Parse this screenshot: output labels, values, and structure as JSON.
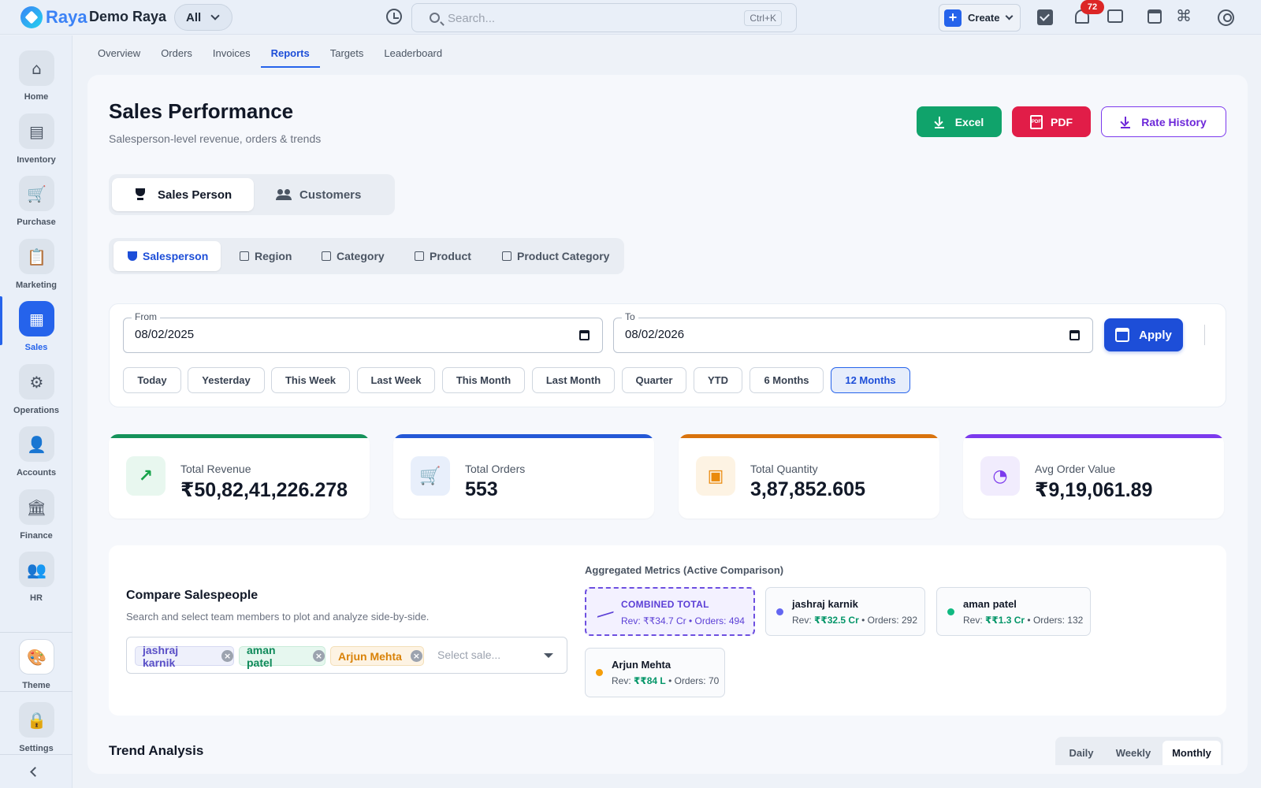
{
  "brand": {
    "logo_text": "Raya",
    "org_name": "Demo Raya",
    "scope": "All"
  },
  "search": {
    "placeholder": "Search...",
    "shortcut": "Ctrl+K"
  },
  "header": {
    "create_label": "Create",
    "notifications_count": "72"
  },
  "sidebar": {
    "items": [
      {
        "label": "Home",
        "icon": "home-icon",
        "glyph": "⌂"
      },
      {
        "label": "Inventory",
        "icon": "archive-icon",
        "glyph": "▤"
      },
      {
        "label": "Purchase",
        "icon": "cart-icon",
        "glyph": "🛒"
      },
      {
        "label": "Marketing",
        "icon": "clipboard-icon",
        "glyph": "📋"
      },
      {
        "label": "Sales",
        "icon": "cash-register-icon",
        "glyph": "▦"
      },
      {
        "label": "Operations",
        "icon": "cog-box-icon",
        "glyph": "⚙"
      },
      {
        "label": "Accounts",
        "icon": "person-icon",
        "glyph": "👤"
      },
      {
        "label": "Finance",
        "icon": "bank-icon",
        "glyph": "🏛"
      },
      {
        "label": "HR",
        "icon": "people-icon",
        "glyph": "👥"
      }
    ],
    "theme_label": "Theme",
    "settings_label": "Settings"
  },
  "tabs": [
    "Overview",
    "Orders",
    "Invoices",
    "Reports",
    "Targets",
    "Leaderboard"
  ],
  "active_tab": "Reports",
  "page": {
    "title": "Sales Performance",
    "subtitle": "Salesperson-level revenue, orders & trends",
    "excel_label": "Excel",
    "pdf_label": "PDF",
    "rate_history_label": "Rate History"
  },
  "view_toggle": {
    "sales_person": "Sales Person",
    "customers": "Customers"
  },
  "dimension_tabs": [
    "Salesperson",
    "Region",
    "Category",
    "Product",
    "Product Category"
  ],
  "filters": {
    "from_label": "From",
    "from_value": "08/02/2025",
    "to_label": "To",
    "to_value": "08/02/2026",
    "apply_label": "Apply",
    "presets": [
      "Today",
      "Yesterday",
      "This Week",
      "Last Week",
      "This Month",
      "Last Month",
      "Quarter",
      "YTD",
      "6 Months",
      "12 Months"
    ],
    "active_preset": "12 Months"
  },
  "kpis": [
    {
      "label": "Total Revenue",
      "value": "₹50,82,41,226.278",
      "color": "#16a34a"
    },
    {
      "label": "Total Orders",
      "value": "553",
      "color": "#2563eb"
    },
    {
      "label": "Total Quantity",
      "value": "3,87,852.605",
      "color": "#ea8a0c"
    },
    {
      "label": "Avg Order Value",
      "value": "₹9,19,061.89",
      "color": "#7c3aed"
    }
  ],
  "compare": {
    "title": "Compare Salespeople",
    "subtitle": "Search and select team members to plot and analyze side-by-side.",
    "selected": [
      "jashraj karnik",
      "aman patel",
      "Arjun Mehta"
    ],
    "placeholder": "Select sale...",
    "agg_title": "Aggregated Metrics (Active Comparison)",
    "combined": {
      "name": "COMBINED TOTAL",
      "rev": "₹₹34.7 Cr",
      "orders": "494"
    },
    "people": [
      {
        "name": "jashraj karnik",
        "rev": "₹₹32.5 Cr",
        "orders": "292",
        "color": "#6366f1"
      },
      {
        "name": "aman patel",
        "rev": "₹₹1.3 Cr",
        "orders": "132",
        "color": "#10b981"
      },
      {
        "name": "Arjun Mehta",
        "rev": "₹₹84 L",
        "orders": "70",
        "color": "#f59e0b"
      }
    ]
  },
  "trend": {
    "title": "Trend Analysis",
    "granularity": [
      "Daily",
      "Weekly",
      "Monthly"
    ],
    "active": "Monthly"
  },
  "labels": {
    "rev_prefix": "Rev: ",
    "orders_prefix": " • Orders: "
  }
}
